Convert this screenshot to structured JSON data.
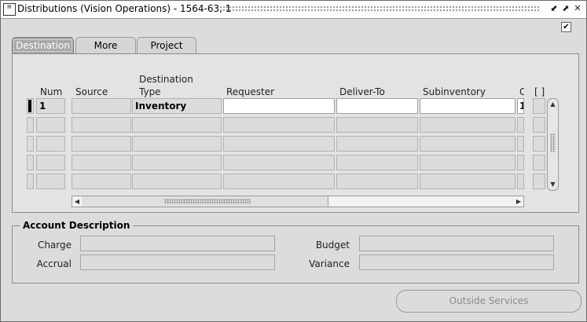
{
  "window": {
    "title": "Distributions (Vision Operations) - 1564-63, 1",
    "controls": [
      "minimize-icon",
      "maximize-icon",
      "close-icon"
    ],
    "corner_check": "✔"
  },
  "tabs": [
    {
      "label": "Destination",
      "active": true
    },
    {
      "label": "More",
      "active": false
    },
    {
      "label": "Project",
      "active": false
    }
  ],
  "table": {
    "headers": {
      "num": "Num",
      "source": "Source",
      "destination_type_1": "Destination",
      "destination_type_2": "Type",
      "requester": "Requester",
      "deliver_to": "Deliver-To",
      "subinventory": "Subinventory",
      "cut": "C",
      "flex": "[ ]"
    },
    "rows": [
      {
        "num": "1",
        "source": "",
        "destination_type": "Inventory",
        "requester": "",
        "deliver_to": "",
        "subinventory": "",
        "cut": "1"
      },
      {
        "num": "",
        "source": "",
        "destination_type": "",
        "requester": "",
        "deliver_to": "",
        "subinventory": "",
        "cut": ""
      },
      {
        "num": "",
        "source": "",
        "destination_type": "",
        "requester": "",
        "deliver_to": "",
        "subinventory": "",
        "cut": ""
      },
      {
        "num": "",
        "source": "",
        "destination_type": "",
        "requester": "",
        "deliver_to": "",
        "subinventory": "",
        "cut": ""
      },
      {
        "num": "",
        "source": "",
        "destination_type": "",
        "requester": "",
        "deliver_to": "",
        "subinventory": "",
        "cut": ""
      }
    ]
  },
  "account_description": {
    "title": "Account Description",
    "charge_label": "Charge",
    "budget_label": "Budget",
    "accrual_label": "Accrual",
    "variance_label": "Variance",
    "charge": "",
    "budget": "",
    "accrual": "",
    "variance": ""
  },
  "buttons": {
    "outside_services": "Outside Services"
  }
}
